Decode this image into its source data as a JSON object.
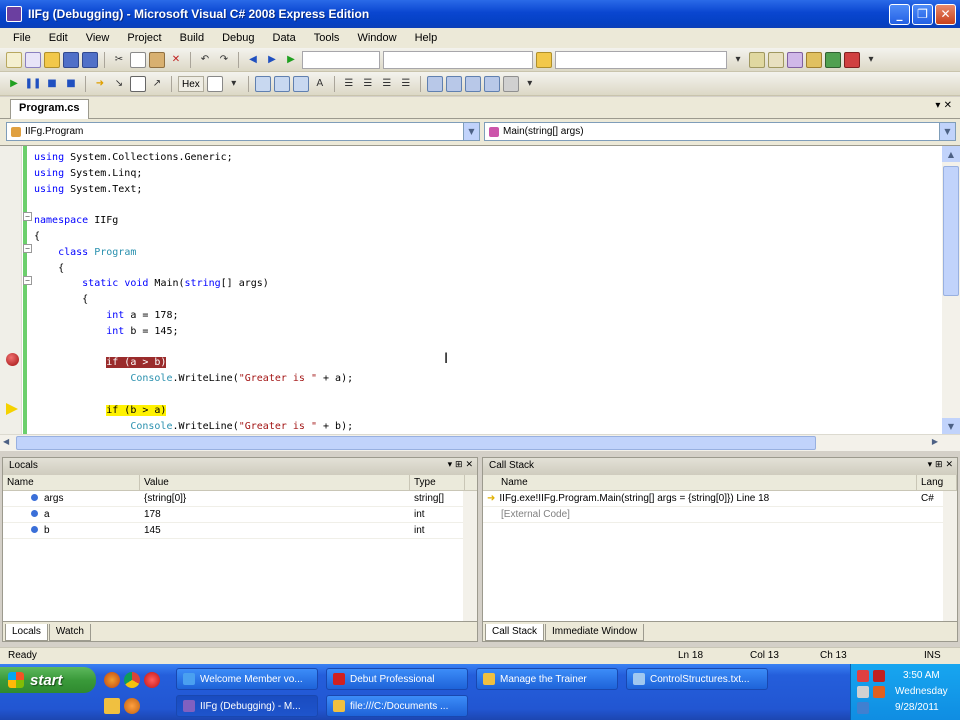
{
  "window": {
    "title": "IIFg (Debugging) - Microsoft Visual C# 2008 Express Edition",
    "controls": {
      "minimize": "_",
      "restore": "❐",
      "close": "✕"
    }
  },
  "menu": [
    "File",
    "Edit",
    "View",
    "Project",
    "Build",
    "Debug",
    "Data",
    "Tools",
    "Window",
    "Help"
  ],
  "toolbar2": {
    "hex_label": "Hex"
  },
  "document_tab": {
    "label": "Program.cs",
    "controls": "▾  ✕"
  },
  "navigation": {
    "class_combo": "IIFg.Program",
    "member_combo": "Main(string[] args)"
  },
  "code": {
    "lines": [
      {
        "segments": [
          {
            "t": "using ",
            "c": "kw"
          },
          {
            "t": "System.Collections.Generic;",
            "c": ""
          }
        ]
      },
      {
        "segments": [
          {
            "t": "using ",
            "c": "kw"
          },
          {
            "t": "System.Linq;",
            "c": ""
          }
        ]
      },
      {
        "segments": [
          {
            "t": "using ",
            "c": "kw"
          },
          {
            "t": "System.Text;",
            "c": ""
          }
        ]
      },
      {
        "segments": []
      },
      {
        "segments": [
          {
            "t": "namespace ",
            "c": "kw"
          },
          {
            "t": "IIFg",
            "c": ""
          }
        ]
      },
      {
        "segments": [
          {
            "t": "{",
            "c": ""
          }
        ]
      },
      {
        "segments": [
          {
            "t": "    class ",
            "c": "kw"
          },
          {
            "t": "Program",
            "c": "ty"
          }
        ]
      },
      {
        "segments": [
          {
            "t": "    {",
            "c": ""
          }
        ]
      },
      {
        "segments": [
          {
            "t": "        static ",
            "c": "kw"
          },
          {
            "t": "void ",
            "c": "kw"
          },
          {
            "t": "Main(",
            "c": ""
          },
          {
            "t": "string",
            "c": "kw"
          },
          {
            "t": "[] args)",
            "c": ""
          }
        ]
      },
      {
        "segments": [
          {
            "t": "        {",
            "c": ""
          }
        ]
      },
      {
        "segments": [
          {
            "t": "            int ",
            "c": "kw"
          },
          {
            "t": "a = 178;",
            "c": ""
          }
        ]
      },
      {
        "segments": [
          {
            "t": "            int ",
            "c": "kw"
          },
          {
            "t": "b = 145;",
            "c": ""
          }
        ]
      },
      {
        "segments": []
      },
      {
        "segments": [
          {
            "t": "            ",
            "c": ""
          },
          {
            "t": "if (a > b)",
            "c": "bp-hl"
          }
        ]
      },
      {
        "segments": [
          {
            "t": "                Console",
            "c": "ty"
          },
          {
            "t": ".WriteLine(",
            "c": ""
          },
          {
            "t": "\"Greater is \"",
            "c": "st"
          },
          {
            "t": " + a);",
            "c": ""
          }
        ]
      },
      {
        "segments": []
      },
      {
        "segments": [
          {
            "t": "            ",
            "c": ""
          },
          {
            "t": "if (b > a)",
            "c": "cur-hl"
          }
        ]
      },
      {
        "segments": [
          {
            "t": "                Console",
            "c": "ty"
          },
          {
            "t": ".WriteLine(",
            "c": ""
          },
          {
            "t": "\"Greater is \"",
            "c": "st"
          },
          {
            "t": " + b);",
            "c": ""
          }
        ]
      }
    ]
  },
  "locals": {
    "title": "Locals",
    "columns": [
      "Name",
      "Value",
      "Type"
    ],
    "rows": [
      {
        "name": "args",
        "value": "{string[0]}",
        "type": "string[]"
      },
      {
        "name": "a",
        "value": "178",
        "type": "int"
      },
      {
        "name": "b",
        "value": "145",
        "type": "int"
      }
    ],
    "tabs": [
      "Locals",
      "Watch"
    ]
  },
  "callstack": {
    "title": "Call Stack",
    "columns": [
      "Name",
      "Lang"
    ],
    "rows": [
      {
        "name": "IIFg.exe!IIFg.Program.Main(string[] args = {string[0]}) Line 18",
        "lang": "C#"
      },
      {
        "name": "[External Code]",
        "lang": ""
      }
    ],
    "tabs": [
      "Call Stack",
      "Immediate Window"
    ]
  },
  "status": {
    "left": "Ready",
    "ln": "Ln 18",
    "col": "Col 13",
    "ch": "Ch 13",
    "mode": "INS"
  },
  "taskbar": {
    "start": "start",
    "tasks_top": [
      "Welcome Member vo...",
      "Debut Professional",
      "Manage the Trainer",
      "ControlStructures.txt..."
    ],
    "tasks_bottom": [
      "IIFg (Debugging) - M...",
      "file:///C:/Documents ..."
    ],
    "clock": {
      "time": "3:50 AM",
      "day": "Wednesday",
      "date": "9/28/2011"
    }
  },
  "colors": {
    "breakpoint": "#9a2b2b",
    "current_statement": "#fff200",
    "keyword": "#0000ff",
    "type": "#2b91af",
    "string": "#a31515"
  }
}
